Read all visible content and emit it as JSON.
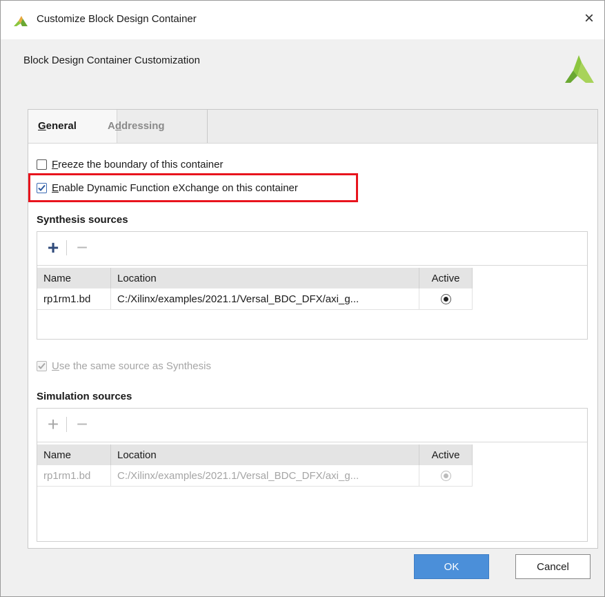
{
  "window": {
    "title": "Customize Block Design Container",
    "close_glyph": "×"
  },
  "header": {
    "text": "Block Design Container Customization"
  },
  "tabs": [
    {
      "prefix": "",
      "underline": "G",
      "rest": "eneral",
      "active": true
    },
    {
      "prefix": "A",
      "underline": "d",
      "rest": "dressing",
      "active": false
    }
  ],
  "options": {
    "freeze": {
      "underline": "F",
      "rest": "reeze the boundary of this container",
      "checked": false
    },
    "dfx": {
      "underline": "E",
      "rest": "nable Dynamic Function eXchange on this container",
      "checked": true
    },
    "same_source": {
      "underline": "U",
      "rest": "se the same source as Synthesis",
      "checked": true,
      "disabled": true
    }
  },
  "synthesis": {
    "title": "Synthesis sources",
    "add_glyph": "+",
    "remove_glyph": "−",
    "columns": [
      "Name",
      "Location",
      "Active"
    ],
    "rows": [
      {
        "name": "rp1rm1.bd",
        "location": "C:/Xilinx/examples/2021.1/Versal_BDC_DFX/axi_g...",
        "active": true
      }
    ]
  },
  "simulation": {
    "title": "Simulation sources",
    "add_glyph": "+",
    "remove_glyph": "−",
    "columns": [
      "Name",
      "Location",
      "Active"
    ],
    "rows": [
      {
        "name": "rp1rm1.bd",
        "location": "C:/Xilinx/examples/2021.1/Versal_BDC_DFX/axi_g...",
        "active": true
      }
    ]
  },
  "buttons": {
    "ok": "OK",
    "cancel": "Cancel"
  },
  "colors": {
    "highlight": "#e8141d",
    "ok_button": "#4b8fd9",
    "logo_green": "#8cc63f"
  }
}
